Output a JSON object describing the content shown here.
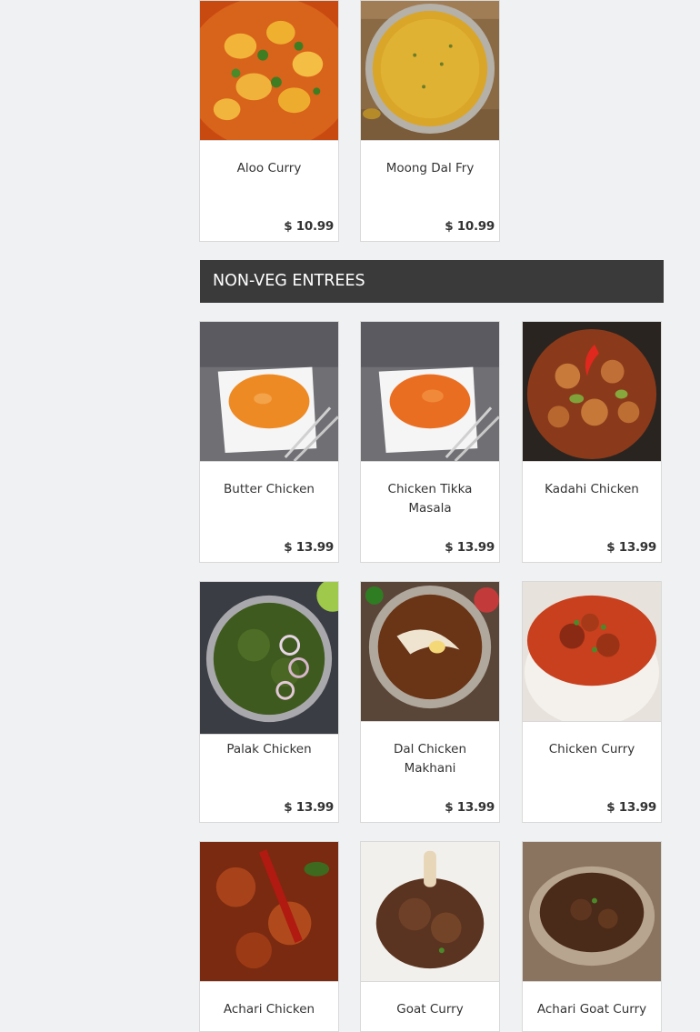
{
  "veg_items": [
    {
      "name": "Aloo Curry",
      "price": "$ 10.99",
      "icon": "aloo-curry-photo"
    },
    {
      "name": "Moong Dal Fry",
      "price": "$ 10.99",
      "icon": "moong-dal-photo"
    }
  ],
  "section": {
    "title": "NON-VEG ENTREES"
  },
  "nonveg_items": [
    {
      "name": "Butter Chicken",
      "price": "$ 13.99"
    },
    {
      "name": "Chicken Tikka Masala",
      "price": "$ 13.99"
    },
    {
      "name": "Kadahi Chicken",
      "price": "$ 13.99"
    },
    {
      "name": "Palak Chicken",
      "price": "$ 13.99"
    },
    {
      "name": "Dal Chicken Makhani",
      "price": "$ 13.99"
    },
    {
      "name": "Chicken Curry",
      "price": "$ 13.99"
    },
    {
      "name": "Achari Chicken",
      "price": ""
    },
    {
      "name": "Goat Curry",
      "price": ""
    },
    {
      "name": "Achari Goat Curry",
      "price": ""
    }
  ],
  "colors": {
    "header_bg": "#3a3a3a",
    "page_bg": "#f0f1f2"
  }
}
